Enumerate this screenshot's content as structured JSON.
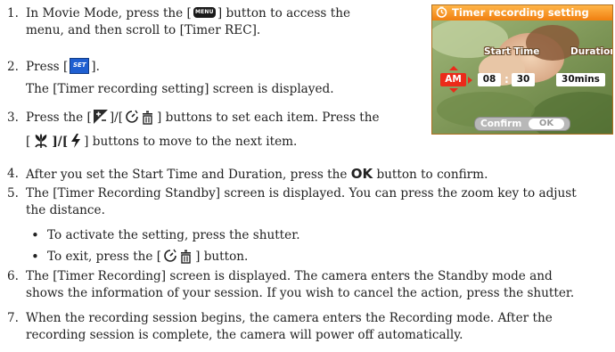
{
  "steps": [
    {
      "num": "1.",
      "line1_a": "In Movie Mode, press the [",
      "menu_icon_label": "MENU",
      "line1_b": "] button to access the",
      "line2": "menu, and then scroll to [Timer REC]."
    },
    {
      "num": "2.",
      "line1_a": "Press [",
      "set_icon_label": "SET",
      "line1_b": "].",
      "line2": "The [Timer recording setting] screen is displayed."
    },
    {
      "num": "3.",
      "line1_a": "Press the [",
      "line1_b": "]/[",
      "line1_c": "] buttons to set each item. Press the",
      "line2_a": "[",
      "line2_b": "]/[",
      "line2_c": "] buttons to move to the next item."
    },
    {
      "num": "4.",
      "text_a": "After you set the Start Time and Duration, press the",
      "ok_label": "OK",
      "text_b": "button to confirm."
    },
    {
      "num": "5.",
      "line1": "The [Timer Recording Standby] screen is displayed. You can press the zoom key to adjust",
      "line2": "the distance.",
      "bullets": [
        {
          "text": "To activate the setting, press the shutter."
        },
        {
          "text_a": "To exit, press the [",
          "text_b": "] button."
        }
      ]
    },
    {
      "num": "6.",
      "line1": "The [Timer Recording] screen is displayed. The camera enters the Standby mode and",
      "line2": "shows the information of your session. If you wish to cancel the action, press the shutter."
    },
    {
      "num": "7.",
      "line1": "When the recording session begins, the camera enters the Recording mode. After the",
      "line2": "recording session is complete, the camera will power off automatically."
    }
  ],
  "bullet_char": "•",
  "icons": {
    "menu": "menu-button-icon",
    "set": "set-button-icon",
    "exposure": "exposure-plus-minus-icon",
    "selftimer_delete": "selftimer-delete-icon",
    "macro": "macro-flower-icon",
    "flash": "flash-icon"
  },
  "camera_screen": {
    "title": "Timer recording setting",
    "start_time_label": "Start Time",
    "duration_label": "Duration",
    "ampm": "AM",
    "hour": "08",
    "colon": ":",
    "minute": "30",
    "duration": "30mins",
    "confirm_label": "Confirm",
    "confirm_button": "OK",
    "colors": {
      "title_bar": "#f59a26",
      "ampm_bg": "#ec2a1a",
      "accent": "#ec2a1a"
    }
  }
}
